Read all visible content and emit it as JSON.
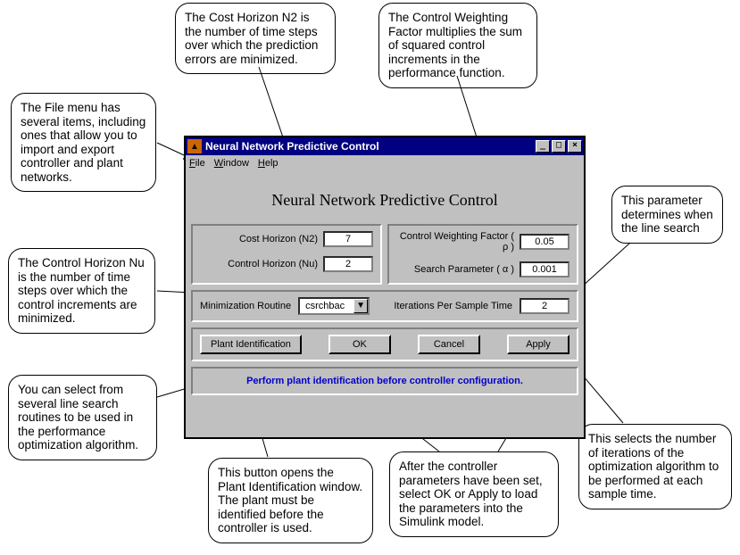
{
  "callouts": {
    "n2": "The Cost Horizon N2 is the number of time steps over which the prediction errors are minimized.",
    "rho": "The Control Weighting Factor multiplies the sum of squared control increments in the performance function.",
    "file": "The File menu has several items, including ones that allow you to import and export controller and plant networks.",
    "alpha": "This parameter determines when the line search",
    "nu": "The Control Horizon Nu is the number of time steps over which the control increments are minimized.",
    "search": "You can select from several line search routines to be used in the performance optimization algorithm.",
    "plant": "This button opens the Plant Identification window. The plant must be identified before the controller is used.",
    "okapply": "After the controller parameters have been set, select OK or Apply to load the parameters into the Simulink model.",
    "iter": "This selects the number of iterations of the optimization algorithm to be performed at each sample time."
  },
  "window": {
    "title": "Neural Network Predictive Control",
    "menu": {
      "file": "File",
      "window": "Window",
      "help": "Help"
    },
    "heading": "Neural Network Predictive Control",
    "labels": {
      "n2": "Cost Horizon (N2)",
      "nu": "Control Horizon (Nu)",
      "rho": "Control Weighting Factor ( ρ )",
      "alpha": "Search Parameter ( α )",
      "routine": "Minimization Routine",
      "iter": "Iterations Per Sample Time"
    },
    "values": {
      "n2": "7",
      "nu": "2",
      "rho": "0.05",
      "alpha": "0.001",
      "routine": "csrchbac",
      "iter": "2"
    },
    "buttons": {
      "plant": "Plant Identification",
      "ok": "OK",
      "cancel": "Cancel",
      "apply": "Apply"
    },
    "status": "Perform plant identification before controller configuration."
  }
}
